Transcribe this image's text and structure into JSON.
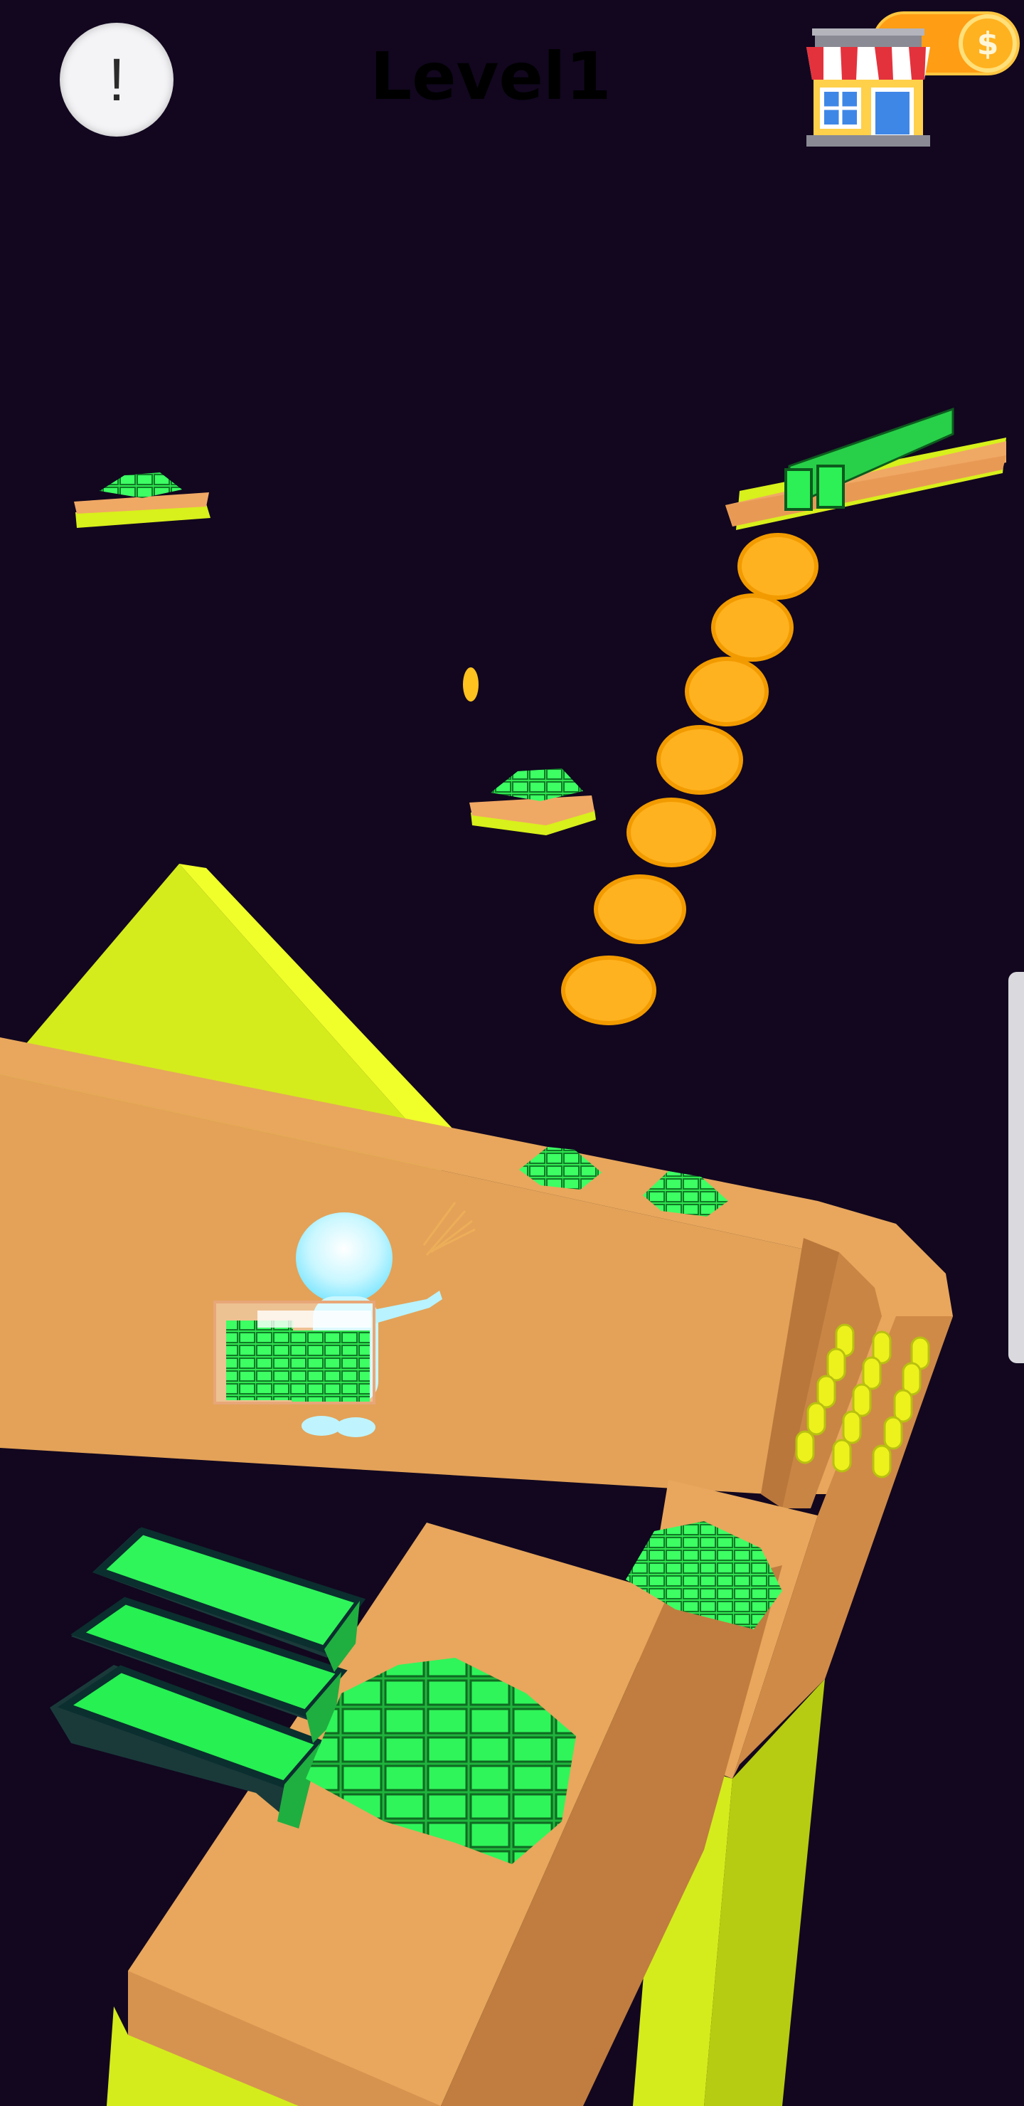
{
  "hud": {
    "help_symbol": "!",
    "level_label": "Level1",
    "coin_symbol": "$",
    "shop_icon": "shop-icon"
  },
  "colors": {
    "background": "#12071f",
    "track": "#e3a258",
    "track_shadow": "#b9773b",
    "accent_lime": "#dff21a",
    "cash_green": "#2fe64f",
    "coin": "#ffb21f"
  }
}
